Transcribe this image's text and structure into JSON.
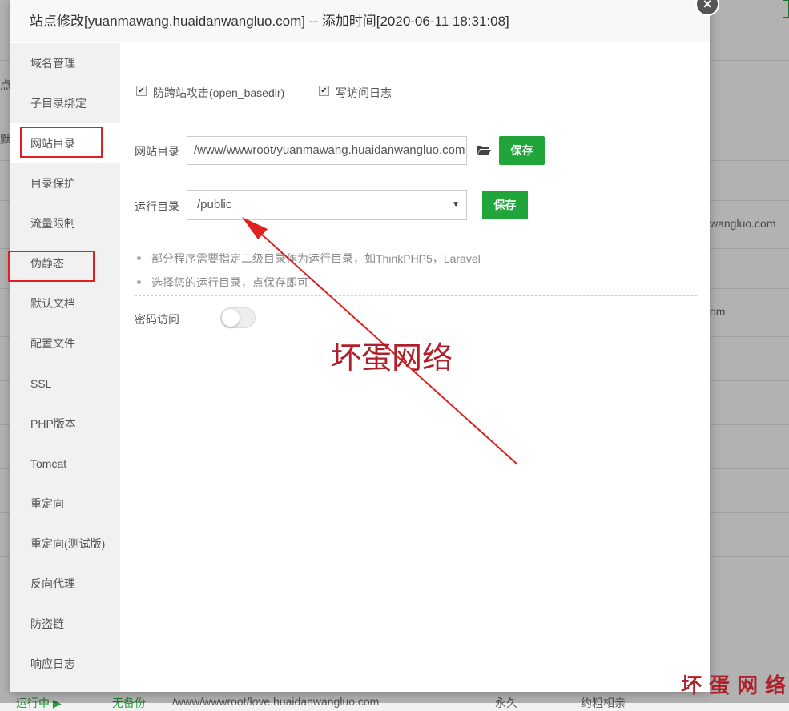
{
  "dialog": {
    "title": "站点修改[yuanmawang.huaidanwangluo.com] -- 添加时间[2020-06-11 18:31:08]",
    "close_label": "×"
  },
  "sidebar": {
    "items": [
      {
        "label": "域名管理"
      },
      {
        "label": "子目录绑定"
      },
      {
        "label": "网站目录"
      },
      {
        "label": "目录保护"
      },
      {
        "label": "流量限制"
      },
      {
        "label": "伪静态"
      },
      {
        "label": "默认文档"
      },
      {
        "label": "配置文件"
      },
      {
        "label": "SSL"
      },
      {
        "label": "PHP版本"
      },
      {
        "label": "Tomcat"
      },
      {
        "label": "重定向"
      },
      {
        "label": "重定向(测试版)"
      },
      {
        "label": "反向代理"
      },
      {
        "label": "防盗链"
      },
      {
        "label": "响应日志"
      }
    ],
    "active_index": 2
  },
  "options": {
    "open_basedir_label": "防跨站攻击(open_basedir)",
    "open_basedir_checked": true,
    "access_log_label": "写访问日志",
    "access_log_checked": true,
    "check_mark": "✔"
  },
  "site_dir": {
    "label": "网站目录",
    "value": "/www/wwwroot/yuanmawang.huaidanwangluo.com",
    "save_label": "保存"
  },
  "run_dir": {
    "label": "运行目录",
    "value": "/public",
    "arrow": "▼",
    "save_label": "保存"
  },
  "tips": [
    "部分程序需要指定二级目录作为运行目录，如ThinkPHP5，Laravel",
    "选择您的运行目录，点保存即可"
  ],
  "password_access": {
    "label": "密码访问",
    "enabled": false
  },
  "watermark": {
    "center_text": "坏蛋网络",
    "corner_text": "坏 蛋 网 络"
  },
  "background": {
    "frag_1": "点",
    "frag_2": "默",
    "frag_3": "wangluo.com",
    "frag_4": "om",
    "footer_status": "运行中 ▶",
    "footer_backup": "无备份",
    "footer_path": "/www/wwwroot/love.huaidanwangluo.com",
    "footer_expire": "永久",
    "footer_note": "约粗相亲"
  },
  "colors": {
    "accent_green": "#20a53a",
    "highlight_red": "#e02020",
    "watermark_red": "#b0202a"
  }
}
